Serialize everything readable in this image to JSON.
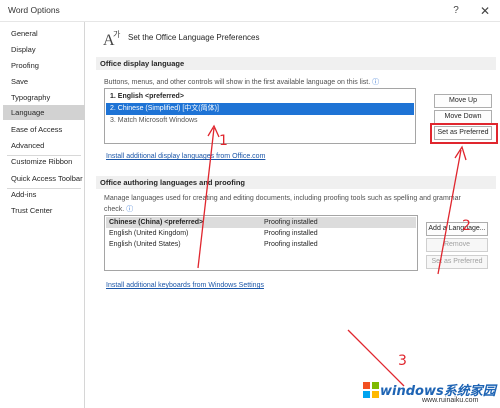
{
  "window": {
    "title": "Word Options",
    "help": "?",
    "close": "✕"
  },
  "sidebar": {
    "items": [
      {
        "label": "General"
      },
      {
        "label": "Display"
      },
      {
        "label": "Proofing"
      },
      {
        "label": "Save"
      },
      {
        "label": "Typography"
      },
      {
        "label": "Language",
        "active": true
      },
      {
        "label": "Ease of Access"
      },
      {
        "label": "Advanced"
      },
      {
        "label": "Customize Ribbon"
      },
      {
        "label": "Quick Access Toolbar"
      },
      {
        "label": "Add-ins"
      },
      {
        "label": "Trust Center"
      }
    ]
  },
  "header": {
    "title": "Set the Office Language Preferences"
  },
  "display_language": {
    "section_title": "Office display language",
    "description": "Buttons, menus, and other controls will show in the first available language on this list.",
    "info_icon": "ⓘ",
    "languages": [
      {
        "label": "1.   English <preferred>"
      },
      {
        "label": "2.   Chinese (Simplified) [中文(简体)]"
      },
      {
        "label": "3.   Match Microsoft Windows"
      }
    ],
    "buttons": {
      "move_up": "Move Up",
      "move_down": "Move Down",
      "set_preferred": "Set as Preferred"
    },
    "install_link": "Install additional display languages from Office.com"
  },
  "authoring": {
    "section_title": "Office authoring languages and proofing",
    "description_line1": "Manage languages used for creating and editing documents, including proofing tools such as spelling and grammar",
    "description_line2": "check.",
    "info_icon": "ⓘ",
    "rows": [
      {
        "language": "Chinese (China) <preferred>",
        "status": "Proofing installed"
      },
      {
        "language": "English (United Kingdom)",
        "status": "Proofing installed"
      },
      {
        "language": "English (United States)",
        "status": "Proofing installed"
      }
    ],
    "buttons": {
      "add_language": "Add a Language...",
      "remove": "Remove",
      "set_preferred": "Set as Preferred"
    },
    "install_link": "Install additional keyboards from Windows Settings"
  },
  "annotations": {
    "one": "1",
    "two": "2",
    "three": "3",
    "color": "#e0262e"
  },
  "watermark": {
    "brand": "windows系统家园",
    "url": "www.ruinaiku.com"
  }
}
